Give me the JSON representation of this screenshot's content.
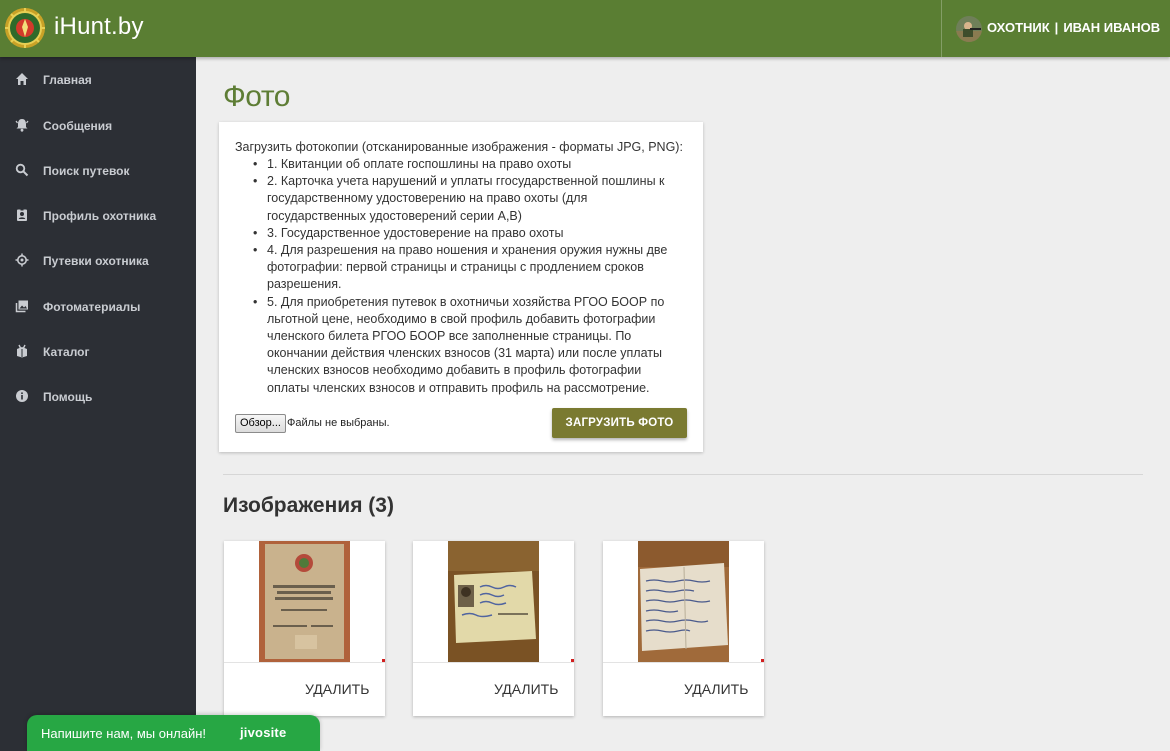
{
  "app": {
    "brand": "iHunt.by",
    "brand_colors": {
      "topbar": "#5a7e33",
      "sidebar": "#2c2f35",
      "accent_button": "#7a7a31",
      "chat": "#27a744"
    }
  },
  "user": {
    "role": "ОХОТНИК",
    "separator": "|",
    "name": "ИВАН ИВАНОВ"
  },
  "sidebar": {
    "items": [
      {
        "label": "Главная",
        "icon": "home-icon"
      },
      {
        "label": "Сообщения",
        "icon": "bell-icon"
      },
      {
        "label": "Поиск путевок",
        "icon": "search-icon"
      },
      {
        "label": "Профиль охотника",
        "icon": "profile-icon"
      },
      {
        "label": "Путевки охотника",
        "icon": "target-icon"
      },
      {
        "label": "Фотоматериалы",
        "icon": "photos-icon"
      },
      {
        "label": "Каталог",
        "icon": "catalog-icon"
      },
      {
        "label": "Помощь",
        "icon": "info-icon"
      }
    ]
  },
  "page": {
    "title": "Фото"
  },
  "upload": {
    "intro": "Загрузить фотокопии (отсканированные изображения - форматы JPG, PNG):",
    "items": [
      "1. Квитанции об оплате госпошлины на право охоты",
      "2. Карточка учета нарушений и уплаты ггосударственной пошлины к государственному удостоверению на право охоты (для государственных удостоверений серии А,В)",
      "3. Государственное удостоверение на право охоты",
      "4. Для разрешения на право ношения и хранения оружия нужны две фотографии: первой страницы и страницы с продлением сроков разрешения.",
      "5. Для приобретения путевок в охотничьи хозяйства РГОО БООР по льготной цене, необходимо в свой профиль добавить фотографии членского билета РГОО БООР все заполненные страницы. По окончании действия членских взносов (31 марта) или после уплаты членских взносов необходимо добавить в профиль фотографии оплаты членских взносов и отправить профиль на рассмотрение."
    ],
    "browse_label": "Обзор...",
    "no_file_text": "Файлы не выбраны.",
    "upload_button": "ЗАГРУЗИТЬ ФОТО"
  },
  "images": {
    "title": "Изображения (3)",
    "cards": [
      {
        "delete_label": "УДАЛИТЬ"
      },
      {
        "delete_label": "УДАЛИТЬ"
      },
      {
        "delete_label": "УДАЛИТЬ"
      }
    ]
  },
  "chat": {
    "text": "Напишите нам, мы онлайн!",
    "brand": "jivosite"
  }
}
